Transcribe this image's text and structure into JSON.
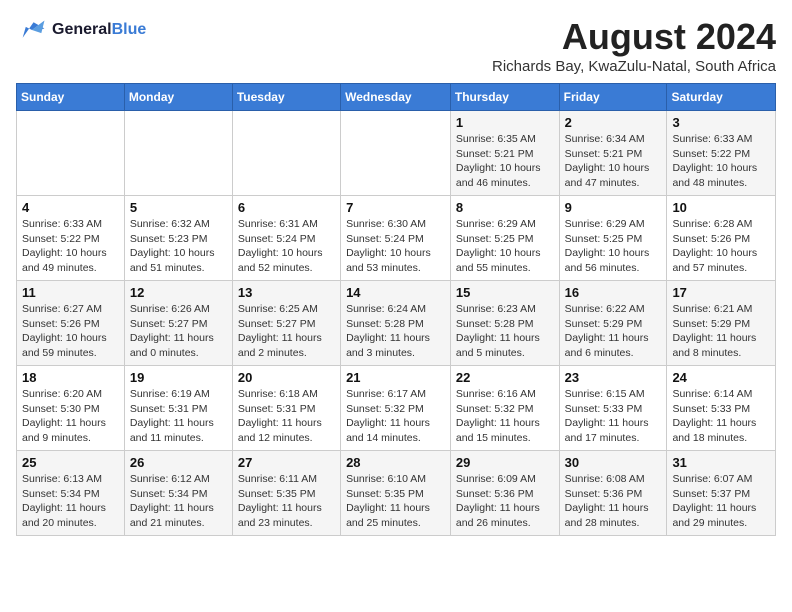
{
  "header": {
    "logo_line1": "General",
    "logo_line2": "Blue",
    "month_year": "August 2024",
    "location": "Richards Bay, KwaZulu-Natal, South Africa"
  },
  "days_of_week": [
    "Sunday",
    "Monday",
    "Tuesday",
    "Wednesday",
    "Thursday",
    "Friday",
    "Saturday"
  ],
  "weeks": [
    [
      {
        "num": "",
        "info": ""
      },
      {
        "num": "",
        "info": ""
      },
      {
        "num": "",
        "info": ""
      },
      {
        "num": "",
        "info": ""
      },
      {
        "num": "1",
        "info": "Sunrise: 6:35 AM\nSunset: 5:21 PM\nDaylight: 10 hours and 46 minutes."
      },
      {
        "num": "2",
        "info": "Sunrise: 6:34 AM\nSunset: 5:21 PM\nDaylight: 10 hours and 47 minutes."
      },
      {
        "num": "3",
        "info": "Sunrise: 6:33 AM\nSunset: 5:22 PM\nDaylight: 10 hours and 48 minutes."
      }
    ],
    [
      {
        "num": "4",
        "info": "Sunrise: 6:33 AM\nSunset: 5:22 PM\nDaylight: 10 hours and 49 minutes."
      },
      {
        "num": "5",
        "info": "Sunrise: 6:32 AM\nSunset: 5:23 PM\nDaylight: 10 hours and 51 minutes."
      },
      {
        "num": "6",
        "info": "Sunrise: 6:31 AM\nSunset: 5:24 PM\nDaylight: 10 hours and 52 minutes."
      },
      {
        "num": "7",
        "info": "Sunrise: 6:30 AM\nSunset: 5:24 PM\nDaylight: 10 hours and 53 minutes."
      },
      {
        "num": "8",
        "info": "Sunrise: 6:29 AM\nSunset: 5:25 PM\nDaylight: 10 hours and 55 minutes."
      },
      {
        "num": "9",
        "info": "Sunrise: 6:29 AM\nSunset: 5:25 PM\nDaylight: 10 hours and 56 minutes."
      },
      {
        "num": "10",
        "info": "Sunrise: 6:28 AM\nSunset: 5:26 PM\nDaylight: 10 hours and 57 minutes."
      }
    ],
    [
      {
        "num": "11",
        "info": "Sunrise: 6:27 AM\nSunset: 5:26 PM\nDaylight: 10 hours and 59 minutes."
      },
      {
        "num": "12",
        "info": "Sunrise: 6:26 AM\nSunset: 5:27 PM\nDaylight: 11 hours and 0 minutes."
      },
      {
        "num": "13",
        "info": "Sunrise: 6:25 AM\nSunset: 5:27 PM\nDaylight: 11 hours and 2 minutes."
      },
      {
        "num": "14",
        "info": "Sunrise: 6:24 AM\nSunset: 5:28 PM\nDaylight: 11 hours and 3 minutes."
      },
      {
        "num": "15",
        "info": "Sunrise: 6:23 AM\nSunset: 5:28 PM\nDaylight: 11 hours and 5 minutes."
      },
      {
        "num": "16",
        "info": "Sunrise: 6:22 AM\nSunset: 5:29 PM\nDaylight: 11 hours and 6 minutes."
      },
      {
        "num": "17",
        "info": "Sunrise: 6:21 AM\nSunset: 5:29 PM\nDaylight: 11 hours and 8 minutes."
      }
    ],
    [
      {
        "num": "18",
        "info": "Sunrise: 6:20 AM\nSunset: 5:30 PM\nDaylight: 11 hours and 9 minutes."
      },
      {
        "num": "19",
        "info": "Sunrise: 6:19 AM\nSunset: 5:31 PM\nDaylight: 11 hours and 11 minutes."
      },
      {
        "num": "20",
        "info": "Sunrise: 6:18 AM\nSunset: 5:31 PM\nDaylight: 11 hours and 12 minutes."
      },
      {
        "num": "21",
        "info": "Sunrise: 6:17 AM\nSunset: 5:32 PM\nDaylight: 11 hours and 14 minutes."
      },
      {
        "num": "22",
        "info": "Sunrise: 6:16 AM\nSunset: 5:32 PM\nDaylight: 11 hours and 15 minutes."
      },
      {
        "num": "23",
        "info": "Sunrise: 6:15 AM\nSunset: 5:33 PM\nDaylight: 11 hours and 17 minutes."
      },
      {
        "num": "24",
        "info": "Sunrise: 6:14 AM\nSunset: 5:33 PM\nDaylight: 11 hours and 18 minutes."
      }
    ],
    [
      {
        "num": "25",
        "info": "Sunrise: 6:13 AM\nSunset: 5:34 PM\nDaylight: 11 hours and 20 minutes."
      },
      {
        "num": "26",
        "info": "Sunrise: 6:12 AM\nSunset: 5:34 PM\nDaylight: 11 hours and 21 minutes."
      },
      {
        "num": "27",
        "info": "Sunrise: 6:11 AM\nSunset: 5:35 PM\nDaylight: 11 hours and 23 minutes."
      },
      {
        "num": "28",
        "info": "Sunrise: 6:10 AM\nSunset: 5:35 PM\nDaylight: 11 hours and 25 minutes."
      },
      {
        "num": "29",
        "info": "Sunrise: 6:09 AM\nSunset: 5:36 PM\nDaylight: 11 hours and 26 minutes."
      },
      {
        "num": "30",
        "info": "Sunrise: 6:08 AM\nSunset: 5:36 PM\nDaylight: 11 hours and 28 minutes."
      },
      {
        "num": "31",
        "info": "Sunrise: 6:07 AM\nSunset: 5:37 PM\nDaylight: 11 hours and 29 minutes."
      }
    ]
  ]
}
